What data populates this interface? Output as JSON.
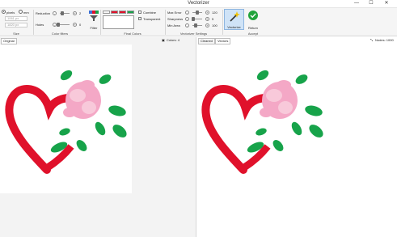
{
  "window": {
    "title": "Vectorizer",
    "minimize": "—",
    "maximize": "☐",
    "close": "✕"
  },
  "size": {
    "unit_pixels": "pixels",
    "unit_mm": "mm",
    "width_value": "1061 px",
    "height_value": "1820 px",
    "group_label": "Size"
  },
  "color_filters": {
    "reduction_label": "Reduction",
    "reduction_value": "2",
    "holes_label": "Holes",
    "holes_value": "0",
    "group_label": "Color filters"
  },
  "filter_button": {
    "label": "Filter"
  },
  "final_colors": {
    "swatches": [
      "#ffffff",
      "#e0112b",
      "#e0112b",
      "#17a34a",
      "#ffffff"
    ],
    "combine_label": "Combine",
    "transparent_label": "Transparent",
    "group_label": "Final Colors"
  },
  "vectorizer_settings": {
    "max_error_label": "Max Error",
    "max_error_value": "120",
    "sharpness_label": "Sharpness",
    "sharpness_value": "5",
    "min_area_label": "Min Area",
    "min_area_value": "100",
    "group_label": "Vectorizer Settings"
  },
  "vectorize_button": {
    "label": "Vectorize"
  },
  "return_button": {
    "label": "Return"
  },
  "accept_group": {
    "label": "Accept"
  },
  "left_pane": {
    "tab": "Original",
    "colors_label": "Colors: 4"
  },
  "right_pane": {
    "tab_cleaned": "Cleaned",
    "tab_vectors": "Vectors",
    "nodes_label": "Nodes: 1000"
  },
  "colors": {
    "red": "#e0112b",
    "green": "#17a34a",
    "pink": "#f4a8c6",
    "pink_light": "#f8c9da",
    "accent": "#2b7fd9"
  }
}
